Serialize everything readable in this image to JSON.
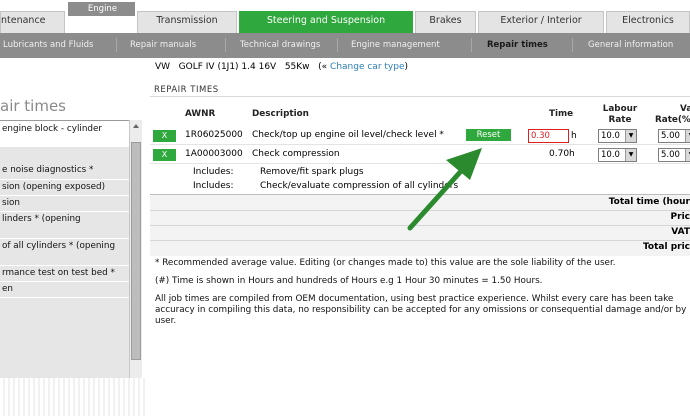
{
  "tabs": [
    {
      "label": "ntenance"
    },
    {
      "label": "Engine"
    },
    {
      "label": "Transmission"
    },
    {
      "label": "Steering and Suspension"
    },
    {
      "label": "Brakes"
    },
    {
      "label": "Exterior / Interior"
    },
    {
      "label": "Electronics"
    }
  ],
  "subnav": [
    {
      "label": "Lubricants and Fluids"
    },
    {
      "label": "Repair manuals"
    },
    {
      "label": "Technical drawings"
    },
    {
      "label": "Engine management"
    },
    {
      "label": "Repair times"
    },
    {
      "label": "General information"
    }
  ],
  "left": {
    "title": "air times",
    "items": [
      {
        "label": "engine block - cylinder"
      },
      {
        "label": "e noise diagnostics *"
      },
      {
        "label": "sion (opening exposed)"
      },
      {
        "label": "sion"
      },
      {
        "label": "linders * (opening"
      },
      {
        "label": "of all cylinders * (opening"
      },
      {
        "label": "rmance test on test bed *"
      },
      {
        "label": "en"
      }
    ]
  },
  "main": {
    "car": {
      "make": "VW",
      "model": "GOLF IV (1J1) 1.4 16V",
      "power": "55Kw",
      "change_open": "(«",
      "change_link": "Change car type",
      "change_close": ")"
    },
    "section_title": "REPAIR TIMES",
    "headers": {
      "awnr": "AWNR",
      "description": "Description",
      "time": "Time",
      "labour_rate_1": "Labour",
      "labour_rate_2": "Rate",
      "vat_1": "Va",
      "vat_2": "Rate(%"
    },
    "rows": [
      {
        "remove": "X",
        "awnr": "1R06025000",
        "description": "Check/top up engine oil level/check level *",
        "reset": "Reset",
        "time_value": "0.30",
        "time_unit": "h",
        "labour_rate": "10.0",
        "vat_rate": "5.00"
      },
      {
        "remove": "X",
        "awnr": "1A00003000",
        "description": "Check compression",
        "time": "0.70h",
        "labour_rate": "10.0",
        "vat_rate": "5.00"
      }
    ],
    "includes": [
      {
        "label": "Includes:",
        "text": "Remove/fit spark plugs"
      },
      {
        "label": "Includes:",
        "text": "Check/evaluate compression of all cylinders"
      }
    ],
    "totals": [
      "Total time (hour",
      "Pric",
      "VAT",
      "Total pric"
    ],
    "notes": [
      "* Recommended average value. Editing (or changes made to) this value are the sole liability of the user.",
      "(#) Time is shown in Hours and hundreds of Hours e.g 1 Hour 30 minutes = 1.50 Hours.",
      "All job times are compiled from OEM documentation, using best practice experience. Whilst every care has been take accuracy in compiling this data, no responsibility can be accepted for any omissions or consequential damage and/or by user."
    ]
  },
  "colors": {
    "accent_green": "#2fa83d",
    "subnav_gray": "#8c8c8c",
    "link_blue": "#2c7fb8",
    "error_red": "#e02020",
    "arrow_green": "#2b8a2e"
  }
}
